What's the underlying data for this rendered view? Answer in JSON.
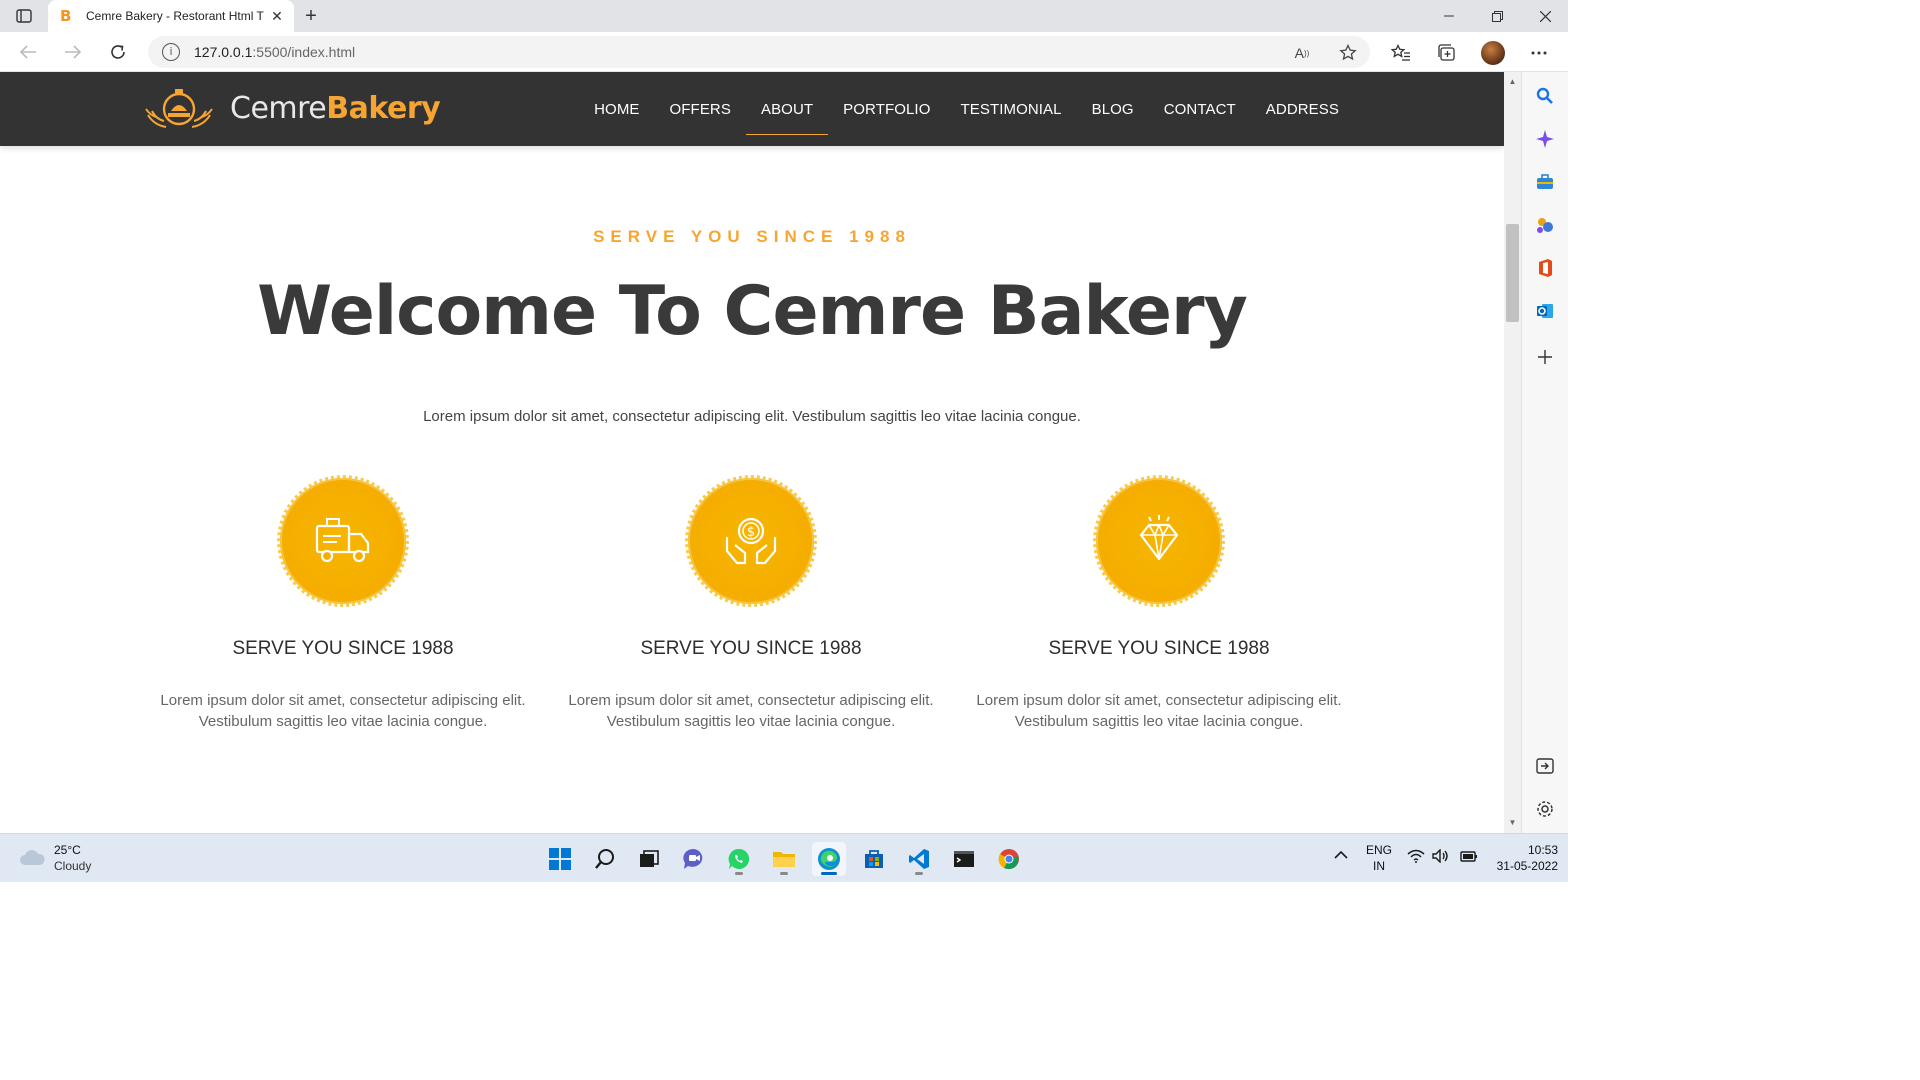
{
  "browser": {
    "tab_title": "Cemre Bakery - Restorant Html T",
    "tab_favicon": "B",
    "url_host": "127.0.0.1",
    "url_path": ":5500/index.html"
  },
  "site": {
    "logo_light": "Cemre",
    "logo_bold": "Bakery",
    "nav": [
      "HOME",
      "OFFERS",
      "ABOUT",
      "PORTFOLIO",
      "TESTIMONIAL",
      "BLOG",
      "CONTACT",
      "ADDRESS"
    ],
    "nav_active": "ABOUT",
    "accent_color": "#f7a532",
    "header_bg": "#333333"
  },
  "about": {
    "eyebrow": "SERVE YOU SINCE 1988",
    "title": "Welcome To Cemre Bakery",
    "lead": "Lorem ipsum dolor sit amet, consectetur adipiscing elit. Vestibulum sagittis leo vitae lacinia congue.",
    "features": [
      {
        "icon": "delivery-truck-icon",
        "title": "SERVE YOU SINCE 1988",
        "text_line1": "Lorem ipsum dolor sit amet, consectetur adipiscing elit.",
        "text_line2": "Vestibulum sagittis leo vitae lacinia congue."
      },
      {
        "icon": "hands-coin-icon",
        "title": "SERVE YOU SINCE 1988",
        "text_line1": "Lorem ipsum dolor sit amet, consectetur adipiscing elit.",
        "text_line2": "Vestibulum sagittis leo vitae lacinia congue."
      },
      {
        "icon": "diamond-icon",
        "title": "SERVE YOU SINCE 1988",
        "text_line1": "Lorem ipsum dolor sit amet, consectetur adipiscing elit.",
        "text_line2": "Vestibulum sagittis leo vitae lacinia congue."
      }
    ]
  },
  "taskbar": {
    "weather_temp": "25°C",
    "weather_cond": "Cloudy",
    "lang_top": "ENG",
    "lang_bottom": "IN",
    "time": "10:53",
    "date": "31-05-2022"
  }
}
